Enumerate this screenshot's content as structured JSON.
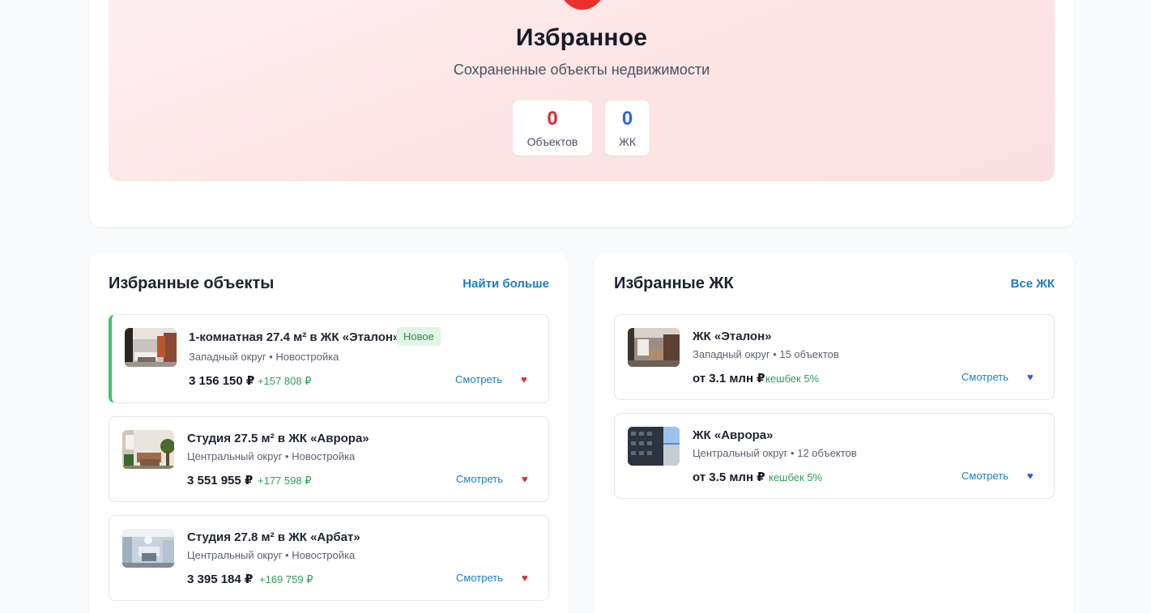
{
  "hero": {
    "title": "Избранное",
    "subtitle": "Сохраненные объекты недвижимости",
    "stats": [
      {
        "value": "0",
        "label": "Объектов"
      },
      {
        "value": "0",
        "label": "ЖК"
      }
    ]
  },
  "objects_panel": {
    "title": "Избранные объекты",
    "link": "Найти больше",
    "items": [
      {
        "title": "1-комнатная 27.4 м² в ЖК «Эталон»",
        "badge": "Новое",
        "subtitle": "Западный округ • Новостройка",
        "price": "3 156 150 ₽",
        "bonus": "+157 808 ₽",
        "view": "Смотреть",
        "favorite_icon": "heart-icon"
      },
      {
        "title": "Студия 27.5 м² в ЖК «Аврора»",
        "subtitle": "Центральный округ • Новостройка",
        "price": "3 551 955 ₽",
        "bonus": "+177 598 ₽",
        "view": "Смотреть",
        "favorite_icon": "heart-icon"
      },
      {
        "title": "Студия 27.8 м² в ЖК «Арбат»",
        "subtitle": "Центральный округ • Новостройка",
        "price": "3 395 184 ₽",
        "bonus": "+169 759 ₽",
        "view": "Смотреть",
        "favorite_icon": "heart-icon"
      }
    ]
  },
  "complexes_panel": {
    "title": "Избранные ЖК",
    "link": "Все ЖК",
    "items": [
      {
        "title": "ЖК «Эталон»",
        "subtitle": "Западный округ • 15 объектов",
        "price": "от 3.1 млн ₽",
        "cashback": "кешбек 5%",
        "view": "Смотреть",
        "favorite_icon": "heart-icon"
      },
      {
        "title": "ЖК «Аврора»",
        "subtitle": "Центральный округ • 12 объектов",
        "price": "от 3.5 млн ₽",
        "cashback": "кешбек 5%",
        "view": "Смотреть",
        "favorite_icon": "heart-icon"
      }
    ]
  },
  "colors": {
    "accent_red": "#dc2f2e",
    "accent_blue": "#2f67d8",
    "link": "#1b7fc1",
    "bonus_green": "#2f9e55",
    "new_border": "#3cc469"
  }
}
